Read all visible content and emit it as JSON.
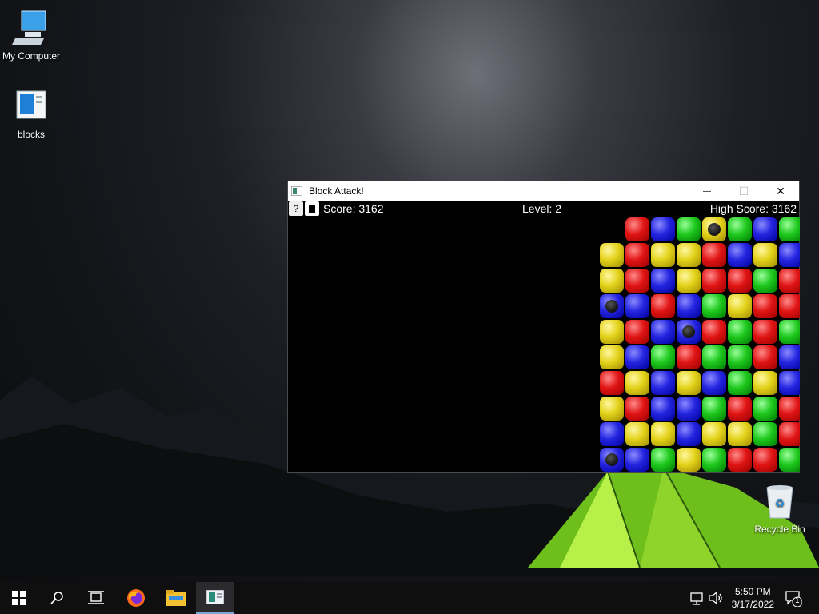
{
  "desktop": {
    "icons": [
      {
        "label": "My Computer",
        "icon": "computer-icon"
      },
      {
        "label": "blocks",
        "icon": "blocks-file-icon"
      },
      {
        "label": "Recycle Bin",
        "icon": "recycle-bin-icon"
      }
    ]
  },
  "window": {
    "title": "Block Attack!",
    "controls": {
      "minimize": "—",
      "maximize": "☐",
      "close": "✕"
    },
    "hud": {
      "help_label": "?",
      "score": "Score: 3162",
      "level": "Level: 2",
      "high_score": "High Score: 3162"
    },
    "board": {
      "rows": [
        [
          "",
          "red",
          "blue",
          "green",
          "yellow-bomb",
          "green",
          "blue",
          "green"
        ],
        [
          "yellow",
          "red",
          "yellow",
          "yellow",
          "red",
          "blue",
          "yellow",
          "blue"
        ],
        [
          "yellow",
          "red",
          "blue",
          "yellow",
          "red",
          "red",
          "green",
          "red"
        ],
        [
          "blue-bomb",
          "blue",
          "red",
          "blue",
          "green",
          "yellow",
          "red",
          "red"
        ],
        [
          "yellow",
          "red",
          "blue",
          "blue-bomb",
          "red",
          "green",
          "red",
          "green"
        ],
        [
          "yellow",
          "blue",
          "green",
          "red",
          "green",
          "green",
          "red",
          "blue"
        ],
        [
          "red",
          "yellow",
          "blue",
          "yellow",
          "blue",
          "green",
          "yellow",
          "blue"
        ],
        [
          "yellow",
          "red",
          "blue",
          "blue",
          "green",
          "red",
          "green",
          "red"
        ],
        [
          "blue",
          "yellow",
          "yellow",
          "blue",
          "yellow",
          "yellow",
          "green",
          "red"
        ],
        [
          "blue-bomb",
          "blue",
          "green",
          "yellow",
          "green",
          "red",
          "red",
          "green"
        ]
      ]
    }
  },
  "taskbar": {
    "items": [
      "start-icon",
      "search-icon",
      "task-view-icon",
      "firefox-icon",
      "file-explorer-icon",
      "block-attack-app-icon"
    ],
    "active_item": "block-attack-app-icon",
    "tray": {
      "time": "5:50 PM",
      "date": "3/17/2022",
      "notification_count": "1"
    }
  }
}
